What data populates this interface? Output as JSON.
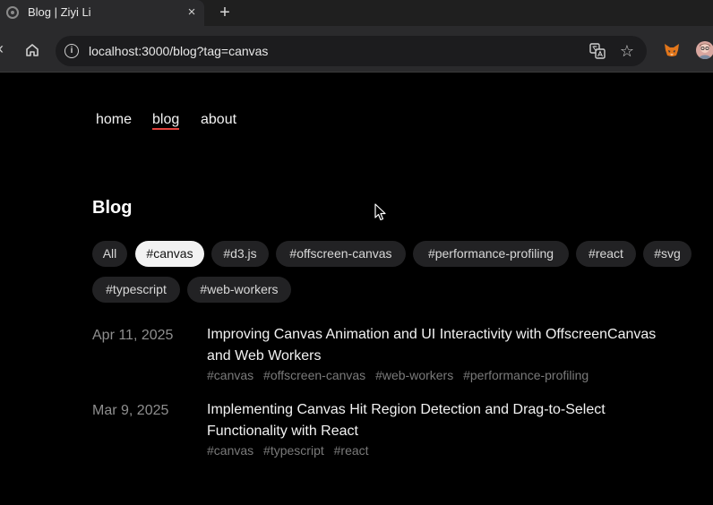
{
  "browser": {
    "tab_title": "Blog | Ziyi Li",
    "tab_close": "×",
    "new_tab": "+",
    "url": "localhost:3000/blog?tag=canvas"
  },
  "nav": {
    "home": "home",
    "blog": "blog",
    "about": "about",
    "active_underline_color": "#e4433d"
  },
  "page_title": "Blog",
  "filters": {
    "active": "#canvas",
    "items": [
      "All",
      "#canvas",
      "#d3.js",
      "#offscreen-canvas",
      "#performance-profiling",
      "#react",
      "#svg",
      "#typescript",
      "#web-workers"
    ]
  },
  "posts": [
    {
      "date": "Apr 11, 2025",
      "title": "Improving Canvas Animation and UI Interactivity with OffscreenCanvas and Web Workers",
      "tags": [
        "#canvas",
        "#offscreen-canvas",
        "#web-workers",
        "#performance-profiling"
      ]
    },
    {
      "date": "Mar 9, 2025",
      "title": "Implementing Canvas Hit Region Detection and Drag-to-Select Functionality with React",
      "tags": [
        "#canvas",
        "#typescript",
        "#react"
      ]
    }
  ]
}
